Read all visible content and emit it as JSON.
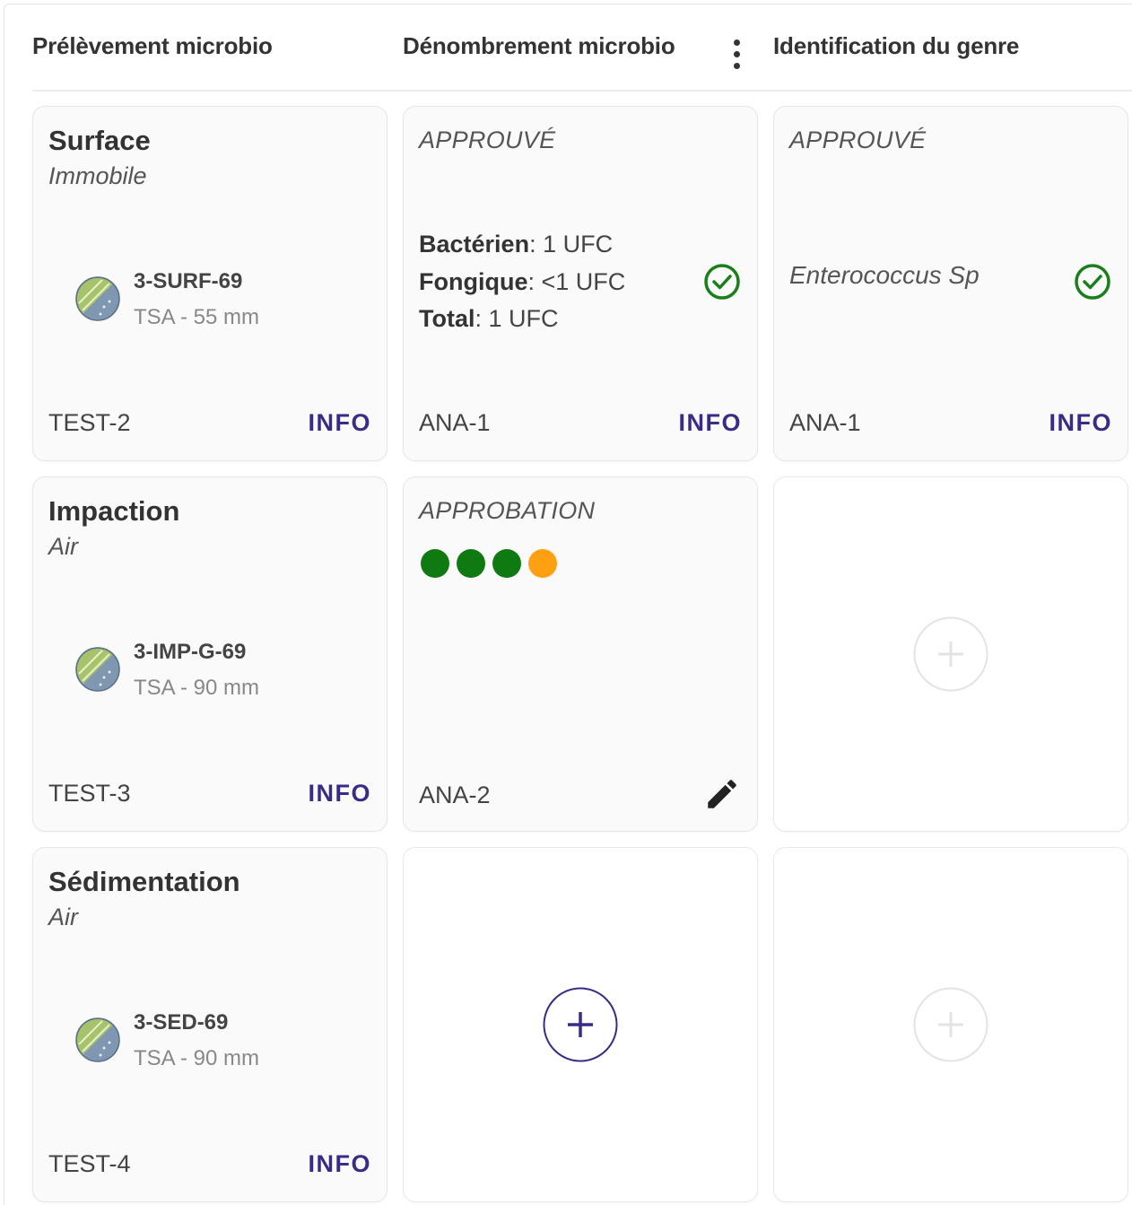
{
  "columns": {
    "col1": "Prélèvement microbio",
    "col2": "Dénombrement microbio",
    "col3": "Identification du genre"
  },
  "colors": {
    "accent": "#3b2b86",
    "success": "#1a7f1a",
    "progress_done": "#0f7a12",
    "progress_pending": "#ff9f12",
    "disabled": "#e0e0e0"
  },
  "rows": [
    {
      "sample": {
        "title": "Surface",
        "subtitle": "Immobile",
        "code": "3-SURF-69",
        "medium": "TSA - 55 mm",
        "id": "TEST-2",
        "info": "INFO"
      },
      "count": {
        "status": "APPROUVÉ",
        "bacterial_label": "Bactérien",
        "bacterial_value": ": 1 UFC",
        "fungal_label": "Fongique",
        "fungal_value": ": <1 UFC",
        "total_label": "Total",
        "total_value": ": 1 UFC",
        "id": "ANA-1",
        "info": "INFO",
        "icon": "check-circle-icon"
      },
      "ident": {
        "status": "APPROUVÉ",
        "species": "Enterococcus Sp",
        "id": "ANA-1",
        "info": "INFO",
        "icon": "check-circle-icon"
      }
    },
    {
      "sample": {
        "title": "Impaction",
        "subtitle": "Air",
        "code": "3-IMP-G-69",
        "medium": "TSA - 90 mm",
        "id": "TEST-3",
        "info": "INFO"
      },
      "count": {
        "status": "APPROBATION",
        "progress": [
          "done",
          "done",
          "done",
          "pending"
        ],
        "id": "ANA-2",
        "icon": "pencil-icon"
      },
      "ident": {
        "empty": true,
        "add_enabled": false
      }
    },
    {
      "sample": {
        "title": "Sédimentation",
        "subtitle": "Air",
        "code": "3-SED-69",
        "medium": "TSA - 90 mm",
        "id": "TEST-4",
        "info": "INFO"
      },
      "count": {
        "empty": true,
        "add_enabled": true
      },
      "ident": {
        "empty": true,
        "add_enabled": false
      }
    }
  ]
}
